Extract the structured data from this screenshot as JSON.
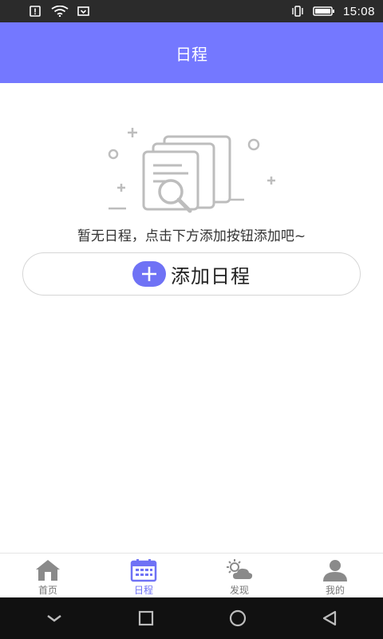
{
  "status_bar": {
    "time": "15:08"
  },
  "app_bar": {
    "title": "日程"
  },
  "empty_state": {
    "message": "暂无日程，点击下方添加按钮添加吧~"
  },
  "add_button": {
    "label": "添加日程"
  },
  "tabs": [
    {
      "label": "首页",
      "icon": "home-icon",
      "active": false
    },
    {
      "label": "日程",
      "icon": "calendar-icon",
      "active": true
    },
    {
      "label": "发现",
      "icon": "weather-icon",
      "active": false
    },
    {
      "label": "我的",
      "icon": "person-icon",
      "active": false
    }
  ],
  "colors": {
    "accent": "#7478ff",
    "button_accent": "#6f72f5",
    "inactive_icon": "#888888"
  }
}
